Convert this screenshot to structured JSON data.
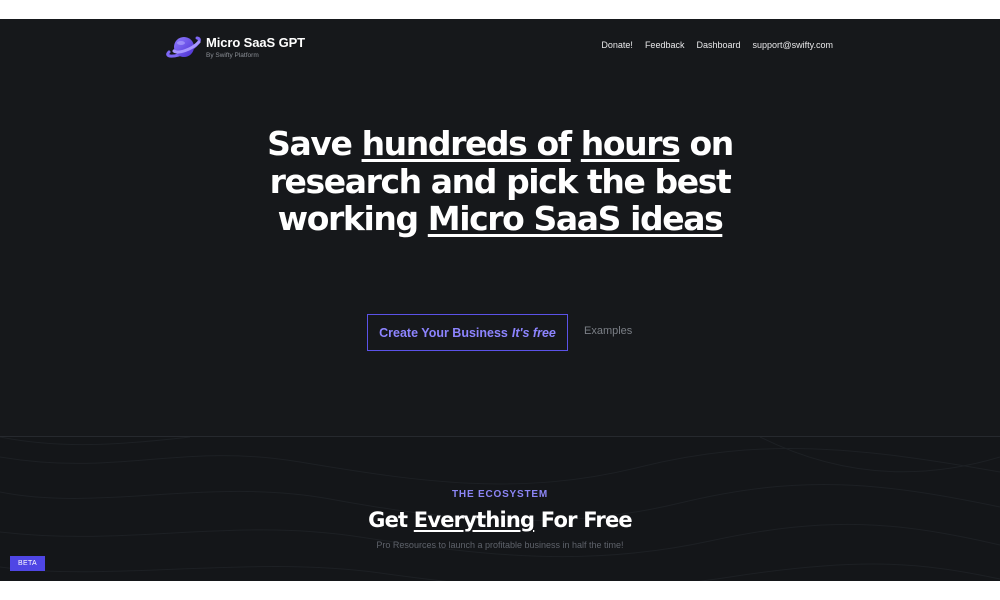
{
  "brand": {
    "title": "Micro SaaS GPT",
    "subtitle": "By Swifty Platform",
    "logo_icon": "planet-icon",
    "accent": "#6d5ce8"
  },
  "nav": {
    "items": [
      {
        "label": "Donate!"
      },
      {
        "label": "Feedback"
      },
      {
        "label": "Dashboard"
      },
      {
        "label": "support@swifty.com"
      }
    ]
  },
  "hero": {
    "segments": [
      {
        "text": "Save ",
        "underline": false
      },
      {
        "text": "hundreds of",
        "underline": true
      },
      {
        "text": " ",
        "underline": false
      },
      {
        "text": "hours",
        "underline": true
      },
      {
        "text": " on research and pick the best working ",
        "underline": false
      },
      {
        "text": "Micro SaaS ideas",
        "underline": true
      }
    ]
  },
  "cta": {
    "primary_label": "Create Your Business",
    "primary_suffix": "It's free",
    "secondary_label": "Examples",
    "accent": "#5b52e8"
  },
  "ecosystem": {
    "kicker": "THE ECOSYSTEM",
    "title_before": "Get ",
    "title_underlined": "Everything",
    "title_after": " For Free",
    "subtitle": "Pro Resources to launch a profitable business in half the time!"
  },
  "badge": {
    "label": "BETA",
    "color": "#4f46e5"
  },
  "colors": {
    "background": "#16181b",
    "text": "#ffffff",
    "muted": "#7b7f86"
  }
}
